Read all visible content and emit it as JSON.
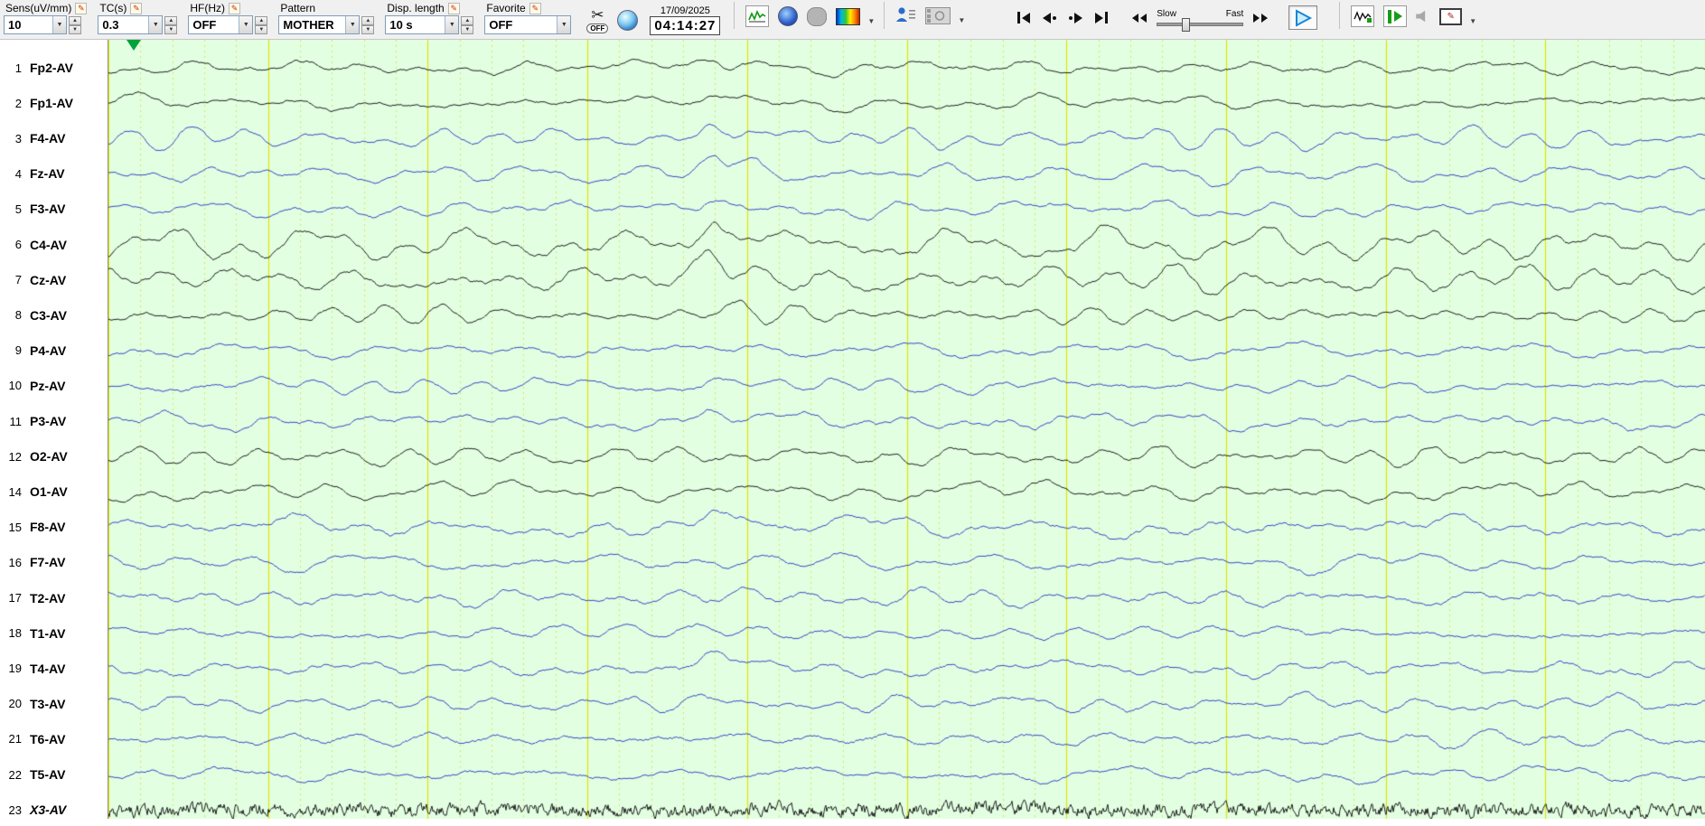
{
  "toolbar": {
    "controls": [
      {
        "label": "Sens(uV/mm)",
        "value": "10"
      },
      {
        "label": "TC(s)",
        "value": "0.3"
      },
      {
        "label": "HF(Hz)",
        "value": "OFF"
      },
      {
        "label": "Pattern",
        "value": "MOTHER"
      },
      {
        "label": "Disp. length",
        "value": "10 s"
      },
      {
        "label": "Favorite",
        "value": "OFF"
      }
    ],
    "cut_badge": "OFF",
    "date": "17/09/2025",
    "time": "04:14:27",
    "speed_slow": "Slow",
    "speed_fast": "Fast"
  },
  "icons": {
    "pencil": "✎",
    "scissors": "✂",
    "caret": "▼",
    "spin_up": "▲",
    "spin_down": "▼",
    "combo_arrow": "▼",
    "monitor_pen": "✎"
  },
  "channels": [
    {
      "num": "1",
      "label": "Fp2-AV",
      "color": "k",
      "amp": 8,
      "spike": 12,
      "hf": 0.5
    },
    {
      "num": "2",
      "label": "Fp1-AV",
      "color": "k",
      "amp": 7,
      "spike": 7,
      "hf": 0.5
    },
    {
      "num": "3",
      "label": "F4-AV",
      "color": "b",
      "amp": 9,
      "spike": 16,
      "hf": 0.5
    },
    {
      "num": "4",
      "label": "Fz-AV",
      "color": "b",
      "amp": 9,
      "spike": 18,
      "hf": 0.5
    },
    {
      "num": "5",
      "label": "F3-AV",
      "color": "b",
      "amp": 8,
      "spike": 10,
      "hf": 0.5
    },
    {
      "num": "6",
      "label": "C4-AV",
      "color": "k",
      "amp": 13,
      "spike": 26,
      "hf": 0.6
    },
    {
      "num": "7",
      "label": "Cz-AV",
      "color": "k",
      "amp": 12,
      "spike": 22,
      "hf": 0.6
    },
    {
      "num": "8",
      "label": "C3-AV",
      "color": "k",
      "amp": 8,
      "spike": 9,
      "hf": 0.5
    },
    {
      "num": "9",
      "label": "P4-AV",
      "color": "b",
      "amp": 8,
      "spike": 5,
      "hf": 0.5
    },
    {
      "num": "10",
      "label": "Pz-AV",
      "color": "b",
      "amp": 8,
      "spike": 5,
      "hf": 0.5
    },
    {
      "num": "11",
      "label": "P3-AV",
      "color": "b",
      "amp": 8,
      "spike": 6,
      "hf": 0.5
    },
    {
      "num": "12",
      "label": "O2-AV",
      "color": "k",
      "amp": 10,
      "spike": 4,
      "hf": 0.5
    },
    {
      "num": "14",
      "label": "O1-AV",
      "color": "k",
      "amp": 9,
      "spike": 8,
      "hf": 0.5
    },
    {
      "num": "15",
      "label": "F8-AV",
      "color": "b",
      "amp": 9,
      "spike": 15,
      "hf": 0.6
    },
    {
      "num": "16",
      "label": "F7-AV",
      "color": "b",
      "amp": 8,
      "spike": 5,
      "hf": 0.6
    },
    {
      "num": "17",
      "label": "T2-AV",
      "color": "b",
      "amp": 8,
      "spike": 5,
      "hf": 0.6
    },
    {
      "num": "18",
      "label": "T1-AV",
      "color": "b",
      "amp": 7,
      "spike": 5,
      "hf": 0.6
    },
    {
      "num": "19",
      "label": "T4-AV",
      "color": "b",
      "amp": 8,
      "spike": 11,
      "hf": 0.6
    },
    {
      "num": "20",
      "label": "T3-AV",
      "color": "b",
      "amp": 7,
      "spike": 3,
      "hf": 0.6
    },
    {
      "num": "21",
      "label": "T6-AV",
      "color": "b",
      "amp": 8,
      "spike": 3,
      "hf": 0.7
    },
    {
      "num": "22",
      "label": "T5-AV",
      "color": "b",
      "amp": 7,
      "spike": 2,
      "hf": 0.6
    },
    {
      "num": "23",
      "label": "X3-AV",
      "color": "k",
      "amp": 1.5,
      "spike": 0,
      "hf": 5,
      "italic": true
    }
  ],
  "colors": {
    "trace_black": "#1c1c1c",
    "trace_blue": "#3646c4",
    "bg": "#e2ffe2",
    "grid_major": "#e2e200",
    "grid_minor": "#d9e455",
    "marker": "#00a33a"
  }
}
